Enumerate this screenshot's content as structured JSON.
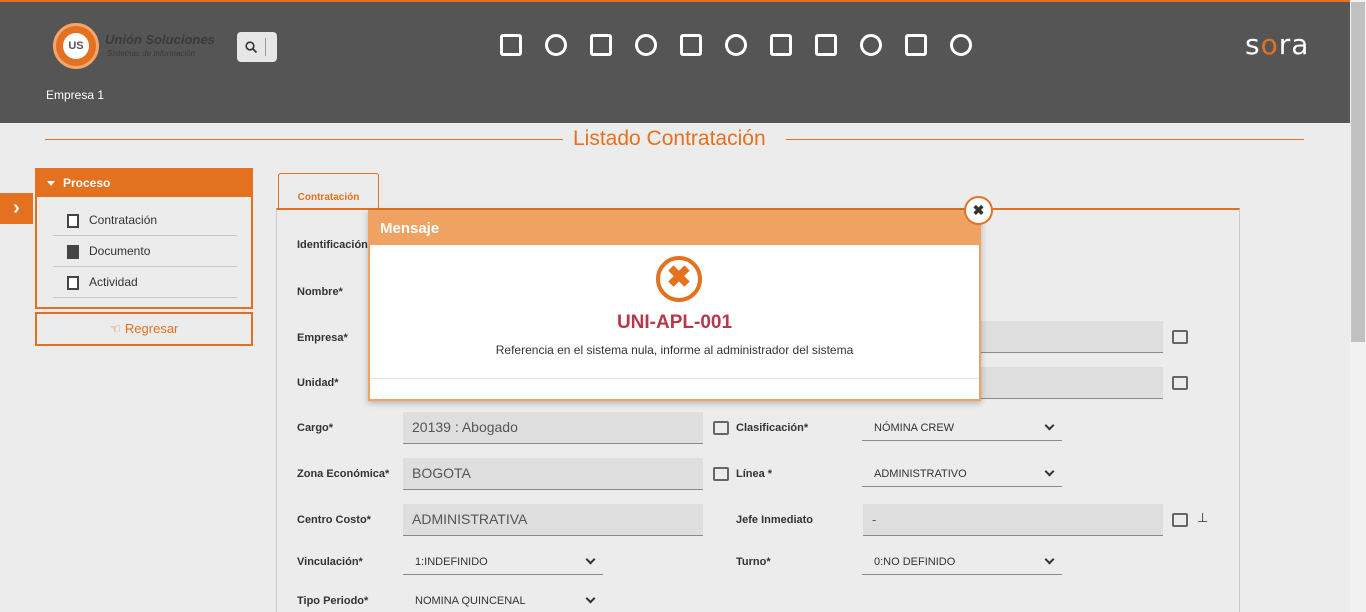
{
  "header": {
    "logo_mark": "US",
    "logo_name": "Unión Soluciones",
    "logo_sub": "Sistemas de Información",
    "brand_pre": "s",
    "brand_mid": "o",
    "brand_post": "ra",
    "company": "Empresa 1",
    "nav_icons": [
      "document-edit-icon",
      "person-badge-icon",
      "gift-icon",
      "org-chart-icon",
      "person-id-icon",
      "timer-icon",
      "list-document-icon",
      "presentation-icon",
      "gears-icon",
      "medical-bag-icon",
      "search-person-icon"
    ]
  },
  "page": {
    "title": "Listado Contratación"
  },
  "sidebar": {
    "section_title": "Proceso",
    "items": [
      {
        "label": "Contratación",
        "icon": "list-icon"
      },
      {
        "label": "Documento",
        "icon": "copy-icon"
      },
      {
        "label": "Actividad",
        "icon": "clipboard-icon"
      }
    ],
    "back_label": "Regresar"
  },
  "tabs": [
    {
      "label": "Contratación"
    }
  ],
  "form": {
    "identificacion_label": "Identificación",
    "nombre_label": "Nombre*",
    "empresa_label": "Empresa*",
    "unidad_label": "Unidad*",
    "cargo_label": "Cargo*",
    "cargo_value": "20139   : Abogado",
    "clasificacion_label": "Clasificación*",
    "clasificacion_value": "NÓMINA CREW",
    "zona_label": "Zona Económica*",
    "zona_value": "BOGOTA",
    "linea_label": "Línea *",
    "linea_value": "ADMINISTRATIVO",
    "centro_label": "Centro Costo*",
    "centro_value": "ADMINISTRATIVA",
    "jefe_label": "Jefe Inmediato",
    "jefe_value": "-",
    "vinculacion_label": "Vinculación*",
    "vinculacion_value": "1:INDEFINIDO",
    "turno_label": "Turno*",
    "turno_value": "0:NO DEFINIDO",
    "tipo_periodo_label": "Tipo Periodo*",
    "tipo_periodo_value": "NOMINA QUINCENAL"
  },
  "modal": {
    "title": "Mensaje",
    "icon": "error-circle-x-icon",
    "code": "UNI-APL-001",
    "message": "Referencia en el sistema nula, informe al administrador del sistema",
    "close_glyph": "✖",
    "error_glyph": "✖"
  },
  "colors": {
    "accent": "#e4711f",
    "header_bg": "#555555",
    "error_code": "#b5394b",
    "modal_head": "#f0a262"
  }
}
